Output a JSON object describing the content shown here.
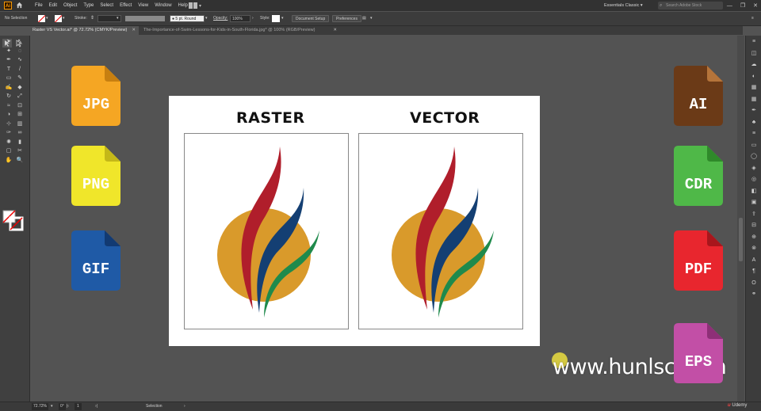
{
  "app": {
    "logo_text": "Ai",
    "menu": [
      "File",
      "Edit",
      "Object",
      "Type",
      "Select",
      "Effect",
      "View",
      "Window",
      "Help"
    ],
    "workspace": "Essentials Classic",
    "search_placeholder": "Search Adobe Stock",
    "window_controls": [
      "—",
      "❐",
      "✕"
    ]
  },
  "control_bar": {
    "selection_label": "No Selection",
    "stroke_label": "Stroke:",
    "brush_label": "5 pt. Round",
    "opacity_label": "Opacity:",
    "opacity_value": "100%",
    "style_label": "Style:",
    "document_setup": "Document Setup",
    "preferences": "Preferences"
  },
  "tabs": [
    {
      "label": "Raster VS Vector.ai* @ 72.72% (CMYK/Preview)",
      "close": "✕",
      "active": true
    },
    {
      "label": "The-Importance-of-Swim-Lessons-for-Kids-in-South-Florida.jpg* @ 100% (RGB/Preview)",
      "close": "✕",
      "active": false
    }
  ],
  "status_bar": {
    "zoom": "72.72%",
    "rotation": "0°",
    "artboard": "1",
    "tool": "Selection"
  },
  "canvas": {
    "left_icons": [
      {
        "ext": "JPG",
        "color": "#f5a623",
        "fold": "#c77f10"
      },
      {
        "ext": "PNG",
        "color": "#f0e62a",
        "fold": "#c4b818"
      },
      {
        "ext": "GIF",
        "color": "#1f5aa6",
        "fold": "#123a72"
      }
    ],
    "right_icons": [
      {
        "ext": "AI",
        "color": "#6b3a17",
        "fold": "#b5743a"
      },
      {
        "ext": "CDR",
        "color": "#4fb848",
        "fold": "#2f8a2a"
      },
      {
        "ext": "PDF",
        "color": "#e8262e",
        "fold": "#a8161c"
      },
      {
        "ext": "EPS",
        "color": "#c24fa6",
        "fold": "#8e2f77"
      }
    ],
    "raster_title": "RASTER",
    "vector_title": "VECTOR",
    "logo_colors": {
      "sun": "#d99a2b",
      "red": "#b01e2b",
      "blue": "#143f73",
      "green": "#1f8a4c"
    }
  },
  "overlay": {
    "watermark": "www.hunlsc.com",
    "brand": "Udemy"
  }
}
